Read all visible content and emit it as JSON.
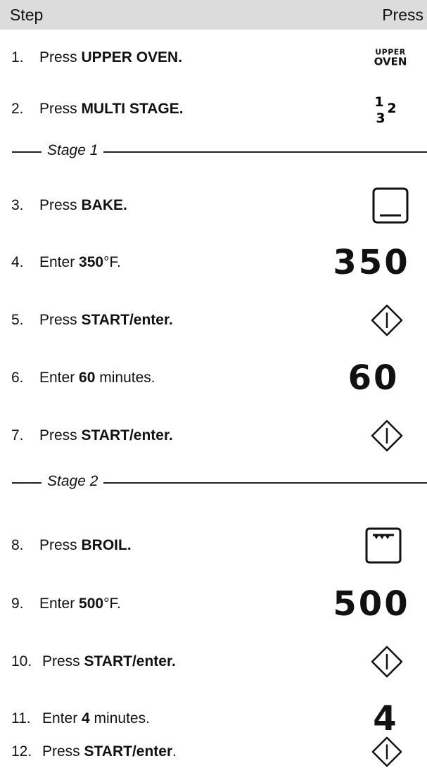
{
  "header": {
    "step_label": "Step",
    "press_label": "Press"
  },
  "steps": [
    {
      "num": "1.",
      "pre": "Press ",
      "bold": "UPPER OVEN.",
      "post": "",
      "control": {
        "icon": "upper-oven-label-icon",
        "line1": "UPPER",
        "line2": "OVEN"
      }
    },
    {
      "num": "2.",
      "pre": "Press ",
      "bold": "MULTI STAGE.",
      "post": "",
      "control": {
        "icon": "multi-stage-icon",
        "digits": [
          "1",
          "2",
          "3"
        ]
      }
    },
    {
      "num": "3.",
      "pre": "Press ",
      "bold": "BAKE.",
      "post": "",
      "control": {
        "icon": "bake-icon"
      }
    },
    {
      "num": "4.",
      "pre": "Enter ",
      "bold": "350",
      "post": "°F.",
      "control": {
        "text": "350"
      }
    },
    {
      "num": "5.",
      "pre": "Press ",
      "bold": "START/enter.",
      "post": "",
      "control": {
        "icon": "start-enter-icon"
      }
    },
    {
      "num": "6.",
      "pre": "Enter ",
      "bold": "60",
      "post": " minutes.",
      "control": {
        "text": "60"
      }
    },
    {
      "num": "7.",
      "pre": "Press ",
      "bold": "START/enter.",
      "post": "",
      "control": {
        "icon": "start-enter-icon"
      }
    },
    {
      "num": "8.",
      "pre": "Press ",
      "bold": "BROIL.",
      "post": "",
      "control": {
        "icon": "broil-icon"
      }
    },
    {
      "num": "9.",
      "pre": "Enter ",
      "bold": "500",
      "post": "°F.",
      "control": {
        "text": "500"
      }
    },
    {
      "num": "10.",
      "pre": "Press ",
      "bold": "START/enter.",
      "post": "",
      "control": {
        "icon": "start-enter-icon"
      }
    },
    {
      "num": "11.",
      "pre": "Enter ",
      "bold": "4",
      "post": " minutes.",
      "control": {
        "text": "4"
      }
    },
    {
      "num": "12.",
      "pre": "Press ",
      "bold": "START/enter",
      "post": ".",
      "control": {
        "icon": "start-enter-icon"
      }
    }
  ],
  "stages": [
    {
      "label": "Stage 1"
    },
    {
      "label": "Stage 2"
    }
  ]
}
